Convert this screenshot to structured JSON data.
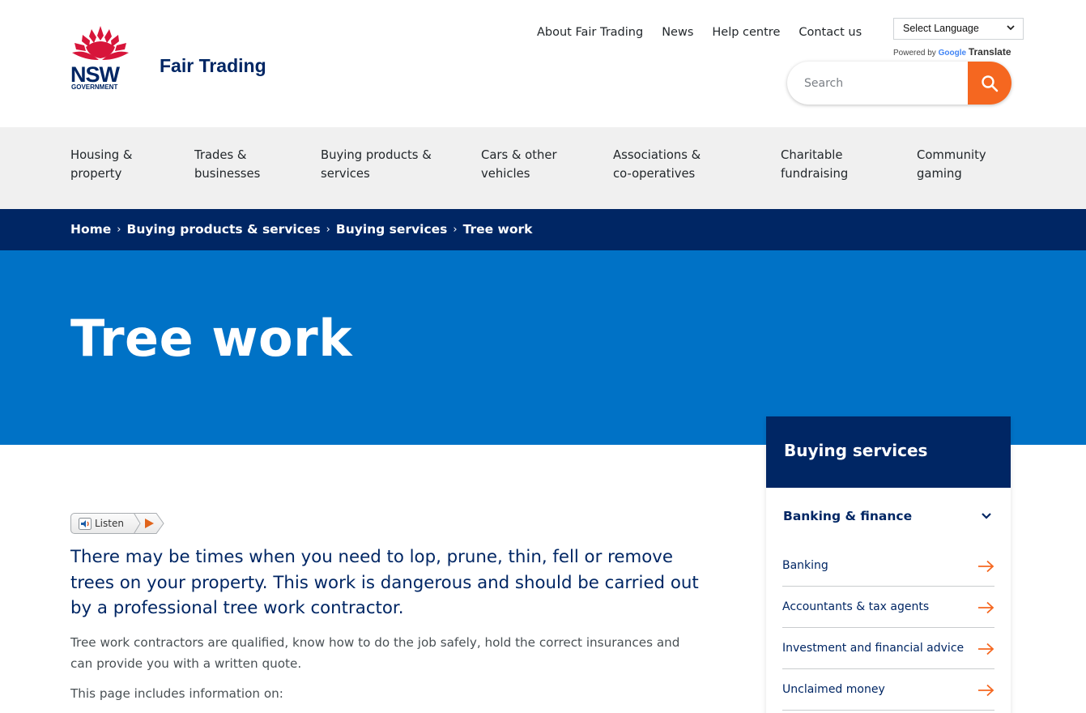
{
  "header": {
    "logo_alt": "NSW Government",
    "site_name": "Fair Trading",
    "utility_nav": [
      "About Fair Trading",
      "News",
      "Help centre",
      "Contact us"
    ],
    "language_select": "Select Language",
    "powered_by": "Powered by",
    "google": "Google",
    "translate": "Translate",
    "search_placeholder": "Search"
  },
  "main_nav": [
    "Housing &\nproperty",
    "Trades &\nbusinesses",
    "Buying products &\nservices",
    "Cars & other\nvehicles",
    "Associations &\nco-operatives",
    "Charitable\nfundraising",
    "Community\ngaming"
  ],
  "breadcrumb": [
    "Home",
    "Buying products & services",
    "Buying services",
    "Tree work"
  ],
  "breadcrumb_separator": "›",
  "page_title": "Tree work",
  "listen_label": "Listen",
  "content": {
    "lead": "There may be times when you need to lop, prune, thin, fell or remove trees on your property. This work is dangerous and should be carried out by a professional tree work contractor.",
    "paragraph1": "Tree work contractors are qualified, know how to do the job safely, hold the correct insurances and can provide you with a written quote.",
    "paragraph2": "This page includes information on:"
  },
  "sidebar": {
    "title": "Buying services",
    "section": "Banking & finance",
    "links": [
      "Banking",
      "Accountants & tax agents",
      "Investment and financial advice",
      "Unclaimed money"
    ]
  },
  "colors": {
    "nsw_navy": "#002664",
    "hero_blue": "#0072c6",
    "accent_orange": "#f56720",
    "waratah_red": "#d7153a",
    "nav_grey": "#f0f0f0"
  }
}
